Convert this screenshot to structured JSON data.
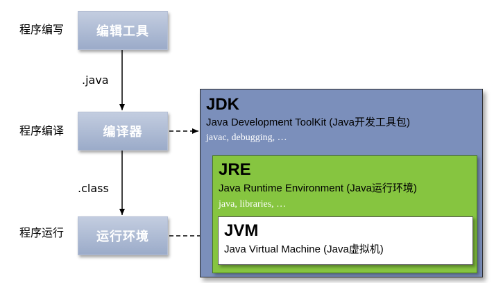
{
  "stages": [
    {
      "step_label": "程序编写",
      "tool_label": "编辑工具"
    },
    {
      "step_label": "程序编译",
      "tool_label": "编译器"
    },
    {
      "step_label": "程序运行",
      "tool_label": "运行环境"
    }
  ],
  "edges": {
    "edit_to_compile": ".java",
    "compile_to_run": ".class"
  },
  "jdk": {
    "title": "JDK",
    "description": "Java Development ToolKit (Java开发工具包)",
    "tools": "javac, debugging, …"
  },
  "jre": {
    "title": "JRE",
    "description": "Java Runtime Environment (Java运行环境)",
    "tools": "java, libraries, …"
  },
  "jvm": {
    "title": "JVM",
    "description": "Java Virtual Machine (Java虚拟机)"
  },
  "colors": {
    "stage_box": "#a9b7d2",
    "jdk_box": "#7b8fbb",
    "jre_box": "#86c540",
    "jvm_box": "#ffffff",
    "arrow": "#000000"
  }
}
